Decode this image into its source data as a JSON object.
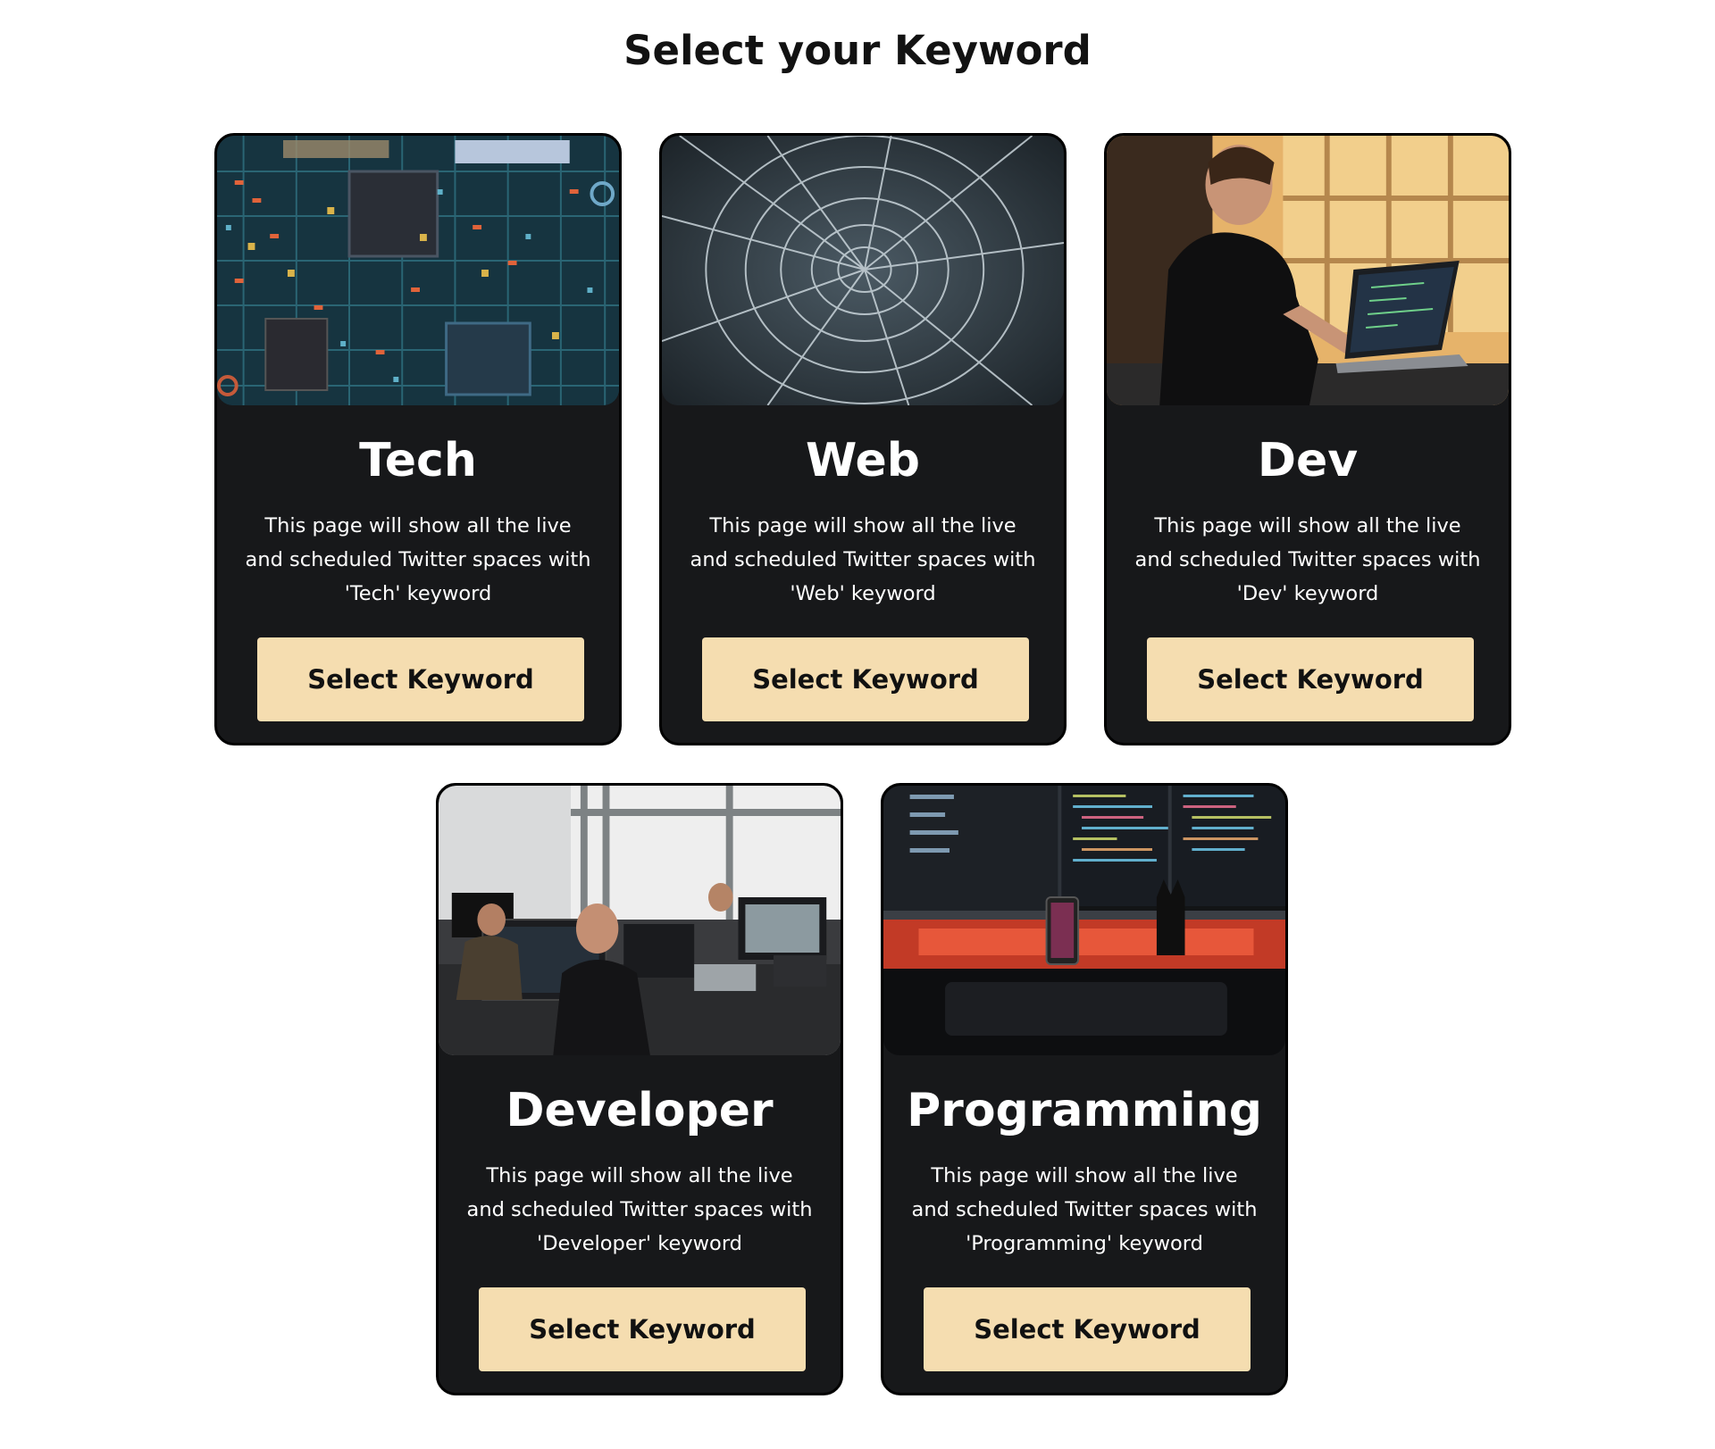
{
  "page": {
    "title": "Select your Keyword"
  },
  "cards": [
    {
      "title": "Tech",
      "description": "This page will show all the live and scheduled Twitter spaces with 'Tech' keyword",
      "button_label": "Select Keyword",
      "image_name": "circuit-board-image"
    },
    {
      "title": "Web",
      "description": "This page will show all the live and scheduled Twitter spaces with 'Web' keyword",
      "button_label": "Select Keyword",
      "image_name": "spider-web-image"
    },
    {
      "title": "Dev",
      "description": "This page will show all the live and scheduled Twitter spaces with 'Dev' keyword",
      "button_label": "Select Keyword",
      "image_name": "man-at-laptop-image"
    },
    {
      "title": "Developer",
      "description": "This page will show all the live and scheduled Twitter spaces with 'Developer' keyword",
      "button_label": "Select Keyword",
      "image_name": "office-developers-image"
    },
    {
      "title": "Programming",
      "description": "This page will show all the live and scheduled Twitter spaces with 'Programming' keyword",
      "button_label": "Select Keyword",
      "image_name": "code-monitors-image"
    }
  ],
  "colors": {
    "card_background": "#17181a",
    "button_background": "#f5ddb0",
    "title_text": "#121212"
  }
}
